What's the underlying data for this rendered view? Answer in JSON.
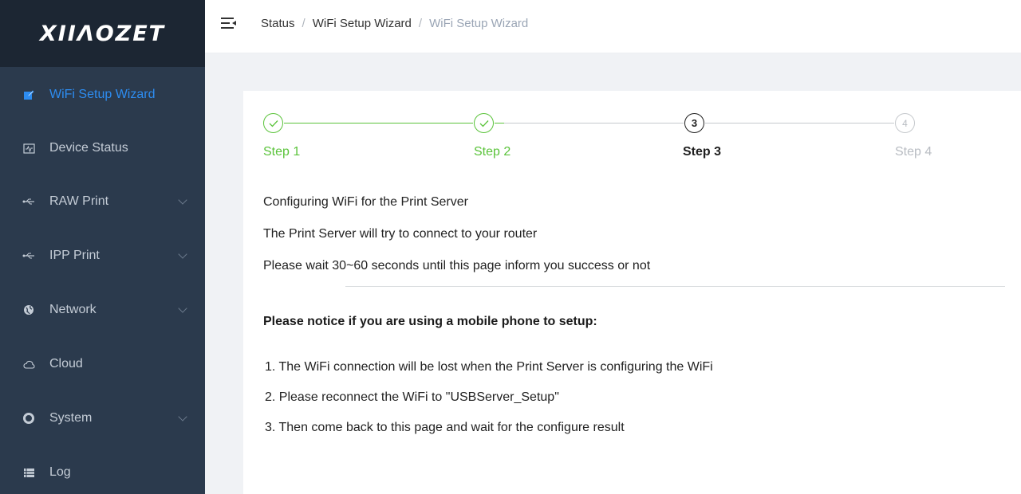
{
  "app": {
    "logo": "XIIΛOZET"
  },
  "sidebar": {
    "items": [
      {
        "label": "WiFi Setup Wizard",
        "icon": "edit-icon",
        "active": true,
        "expandable": false
      },
      {
        "label": "Device Status",
        "icon": "monitor-icon",
        "active": false,
        "expandable": false
      },
      {
        "label": "RAW Print",
        "icon": "usb-icon",
        "active": false,
        "expandable": true
      },
      {
        "label": "IPP Print",
        "icon": "usb-icon",
        "active": false,
        "expandable": true
      },
      {
        "label": "Network",
        "icon": "globe-icon",
        "active": false,
        "expandable": true
      },
      {
        "label": "Cloud",
        "icon": "cloud-icon",
        "active": false,
        "expandable": false
      },
      {
        "label": "System",
        "icon": "gear-icon",
        "active": false,
        "expandable": true
      },
      {
        "label": "Log",
        "icon": "list-icon",
        "active": false,
        "expandable": false
      }
    ]
  },
  "header": {
    "breadcrumb": [
      "Status",
      "WiFi Setup Wizard",
      "WiFi Setup Wizard"
    ],
    "separator": "/"
  },
  "steps": [
    {
      "title": "Step 1",
      "status": "done",
      "number": "1"
    },
    {
      "title": "Step 2",
      "status": "done",
      "number": "2"
    },
    {
      "title": "Step 3",
      "status": "current",
      "number": "3"
    },
    {
      "title": "Step 4",
      "status": "wait",
      "number": "4"
    }
  ],
  "content": {
    "lines": [
      "Configuring WiFi for the Print Server",
      "The Print Server will try to connect to your router",
      "Please wait 30~60 seconds until this page inform you success or not"
    ],
    "notice_title": "Please notice if you are using a mobile phone to setup:",
    "notice_items": [
      "1. The WiFi connection will be lost when the Print Server is configuring the WiFi",
      "2. Please reconnect the WiFi to \"USBServer_Setup\"",
      "3. Then come back to this page and wait for the configure result"
    ]
  },
  "colors": {
    "sidebar_bg": "#2b3a4d",
    "logo_bg": "#1c2633",
    "active": "#2d8cf0",
    "success": "#5ac33a"
  }
}
